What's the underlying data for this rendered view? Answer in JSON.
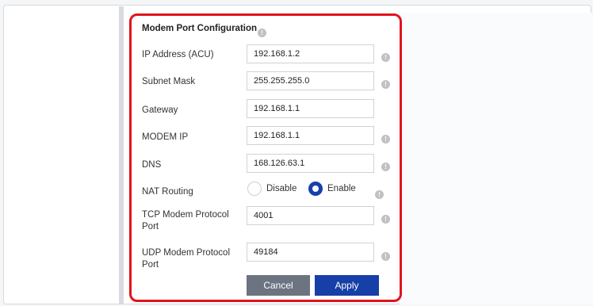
{
  "panel": {
    "title": "Modem Port Configuration",
    "info_glyph": "!"
  },
  "fields": [
    {
      "label": "IP Address (ACU)",
      "value": "192.168.1.2",
      "has_info": true
    },
    {
      "label": "Subnet Mask",
      "value": "255.255.255.0",
      "has_info": true
    },
    {
      "label": "Gateway",
      "value": "192.168.1.1",
      "has_info": false
    },
    {
      "label": "MODEM IP",
      "value": "192.168.1.1",
      "has_info": true
    },
    {
      "label": "DNS",
      "value": "168.126.63.1",
      "has_info": true
    }
  ],
  "nat": {
    "label": "NAT Routing",
    "options": [
      "Disable",
      "Enable"
    ],
    "selected": "Enable"
  },
  "tcp": {
    "label_line1": "TCP Modem Protocol",
    "label_line2": "Port",
    "value": "4001"
  },
  "udp": {
    "label_line1": "UDP Modem Protocol",
    "label_line2": "Port",
    "value": "49184"
  },
  "buttons": {
    "cancel": "Cancel",
    "apply": "Apply"
  },
  "colors": {
    "highlight_border": "#e0141e",
    "primary": "#163fa8",
    "secondary": "#6b7480"
  }
}
